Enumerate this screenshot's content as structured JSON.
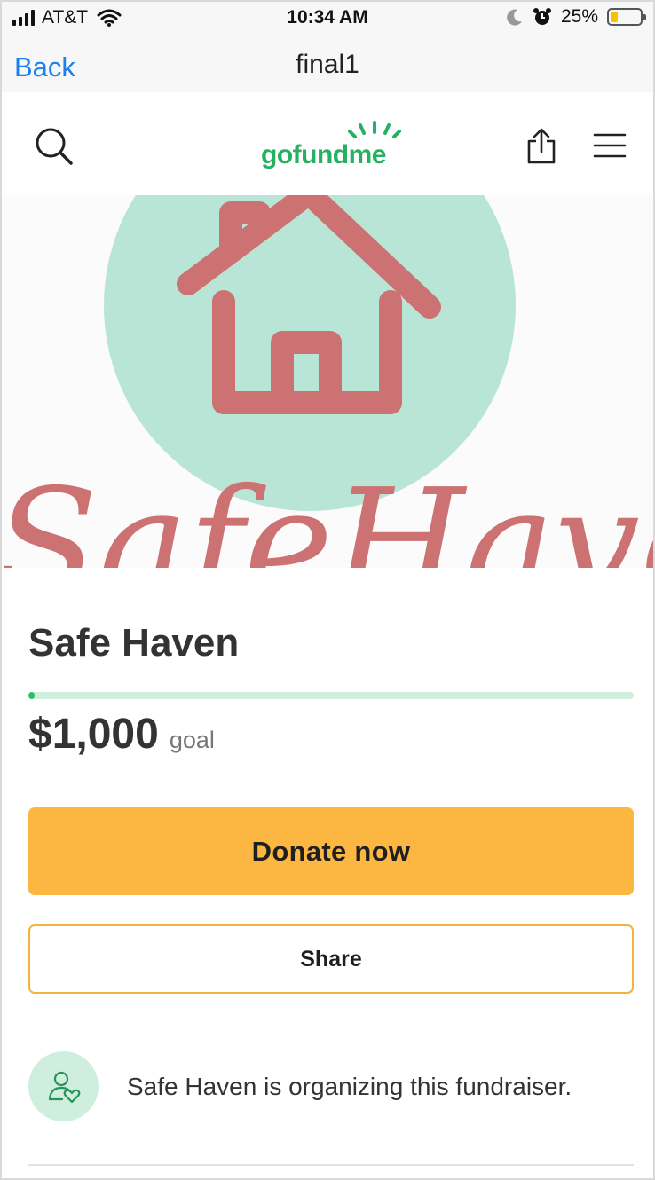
{
  "status_bar": {
    "carrier": "AT&T",
    "time": "10:34 AM",
    "battery_percent": "25%",
    "battery_level": 0.25,
    "icons": [
      "signal-icon",
      "wifi-icon",
      "moon-icon",
      "alarm-icon",
      "battery-icon"
    ]
  },
  "nav": {
    "back_label": "Back",
    "title": "final1"
  },
  "header": {
    "logo_text": "gofundme",
    "icons": [
      "search-icon",
      "share-upload-icon",
      "menu-icon"
    ]
  },
  "hero": {
    "image_text": "SafeHaven",
    "icon": "house-icon"
  },
  "campaign": {
    "title": "Safe Haven",
    "progress": 0.01,
    "amount": "$1,000",
    "goal_label": "goal"
  },
  "actions": {
    "donate_label": "Donate now",
    "share_label": "Share"
  },
  "organizer": {
    "text": "Safe Haven is organizing this fundraiser.",
    "icon": "organizer-heart-icon"
  },
  "colors": {
    "brand_green": "#27b062",
    "donate_yellow": "#fbb741",
    "ios_blue": "#1a7ff0",
    "progress_track": "#cfeedd",
    "hero_circle": "#b9e5d6",
    "hero_house": "#cc7272"
  }
}
